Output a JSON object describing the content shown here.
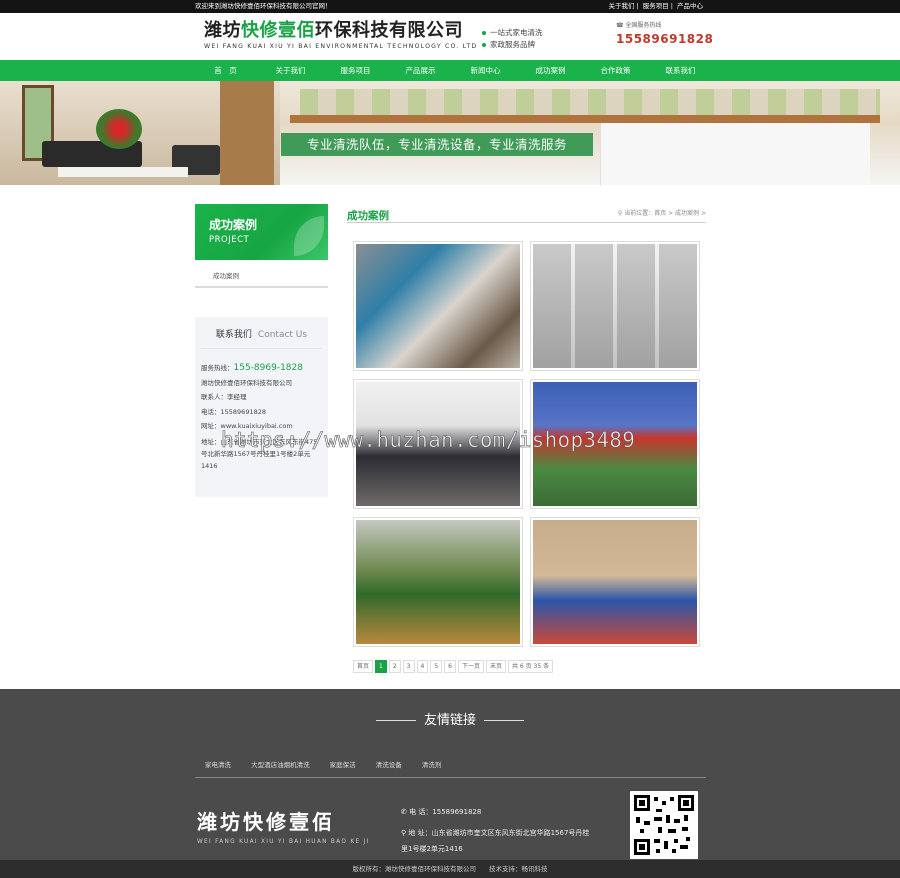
{
  "topbar": {
    "welcome": "欢迎来到潍坊快修壹佰环保科技有限公司官网！",
    "links": [
      "关于我们",
      "服务项目",
      "产品中心"
    ]
  },
  "header": {
    "company_green": "快修壹佰",
    "company_prefix": "潍坊",
    "company_suffix": "环保科技有限公司",
    "company_en": "WEI FANG KUAI XIU YI BAI ENVIRONMENTAL TECHNOLOGY CO. LTD",
    "slogans": [
      "一站式家电清洗",
      "家政服务品牌"
    ],
    "hotline_label": "全国服务热线",
    "hotline": "15589691828"
  },
  "nav": [
    "首　页",
    "关于我们",
    "服务项目",
    "产品展示",
    "新闻中心",
    "成功案例",
    "合作政策",
    "联系我们"
  ],
  "banner": {
    "caption": "专业清洗队伍，专业清洗设备，专业清洗服务"
  },
  "sidebar": {
    "title": "成功案例",
    "title_en": "PROJECT",
    "menu_item": "成功案例",
    "contact": {
      "title": "联系我们",
      "title_en": "Contact Us",
      "hotline_label": "服务热线：",
      "hotline": "155-8969-1828",
      "company": "潍坊快修壹佰环保科技有限公司",
      "person": "联系人：李经理",
      "phone": "电话：15589691828",
      "web": "网址：www.kuaixiuyibai.com",
      "address": "地址：山东省潍坊市奎文区东风东街475号北新华路1567号丹桂里1号楼2单元1416"
    }
  },
  "main": {
    "title": "成功案例",
    "breadcrumb": "当前位置：首页 > 成功案例 >",
    "pager": [
      "首页",
      "1",
      "2",
      "3",
      "4",
      "5",
      "6",
      "下一页",
      "末页",
      "共 6 页 35 条"
    ],
    "watermark": "https://www.huzhan.com/ishop3489"
  },
  "footer": {
    "friend_title": "友情链接",
    "links": [
      "家电清洗",
      "大型酒店油烟机清洗",
      "家庭保洁",
      "清洗设备",
      "清洗剂"
    ],
    "logo_cn": "潍坊快修壹佰",
    "logo_en": "WEI FANG KUAI XIU YI BAI HUAN BAO KE JI",
    "phone": "电 话：15589691828",
    "address": "地 址：山东省潍坊市奎文区东风东街北宫华路1567号丹桂里1号楼2单元1416",
    "copyright": "版权所有：潍坊快修壹佰环保科技有限公司　　技术支持：畅讯科技"
  }
}
